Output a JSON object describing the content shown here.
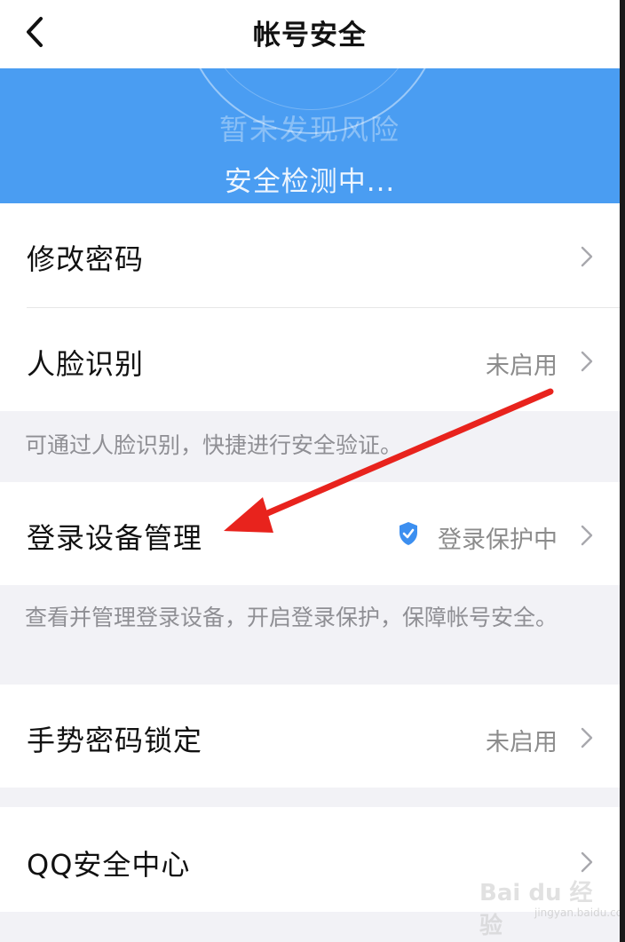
{
  "header": {
    "title": "帐号安全",
    "back_icon": "chevron-left-icon"
  },
  "banner": {
    "risk_text": "暂未发现风险",
    "status_text": "安全检测中...",
    "color": "#4a9df2"
  },
  "items": [
    {
      "label": "修改密码",
      "value": ""
    },
    {
      "label": "人脸识别",
      "value": "未启用",
      "tip": "可通过人脸识别，快捷进行安全验证。"
    },
    {
      "label": "登录设备管理",
      "value": "登录保护中",
      "icon": "shield-check-icon",
      "tip": "查看并管理登录设备，开启登录保护，保障帐号安全。"
    },
    {
      "label": "手势密码锁定",
      "value": "未启用"
    },
    {
      "label": "QQ安全中心",
      "value": ""
    }
  ],
  "annotation": {
    "arrow_color": "#e8231d"
  },
  "watermark": {
    "text": "Bai du 经验",
    "sub": "jingyan.baidu.com"
  }
}
